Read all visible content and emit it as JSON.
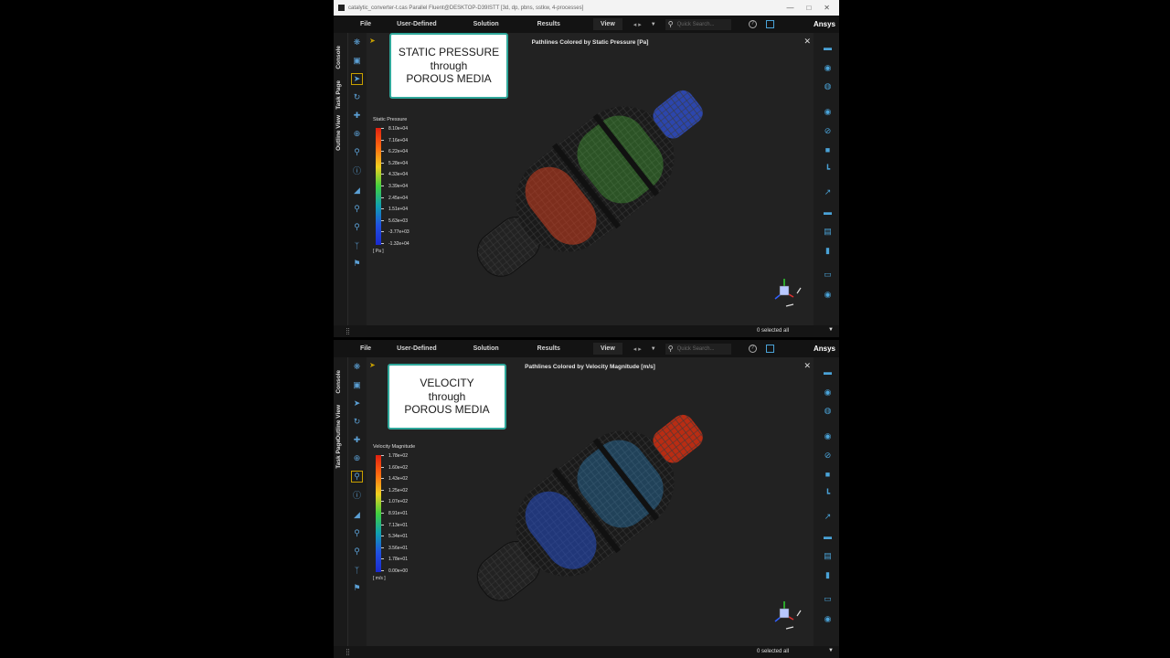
{
  "window": {
    "title": "catalytic_converter-t.cas Parallel Fluent@DESKTOP-D39ISTT [3d, dp, pbns, sstkw, 4-processes]"
  },
  "menu": {
    "file": "File",
    "user_defined": "User-Defined",
    "solution": "Solution",
    "results": "Results",
    "view": "View",
    "search_placeholder": "Quick Search...",
    "brand": "Ansys"
  },
  "side_tabs": {
    "console": "Console",
    "task_page": "Task Page",
    "outline_view": "Outline View"
  },
  "panels": [
    {
      "view_title": "Pathlines Colored by Static Pressure [Pa]",
      "callout": [
        "STATIC PRESSURE",
        "through",
        "POROUS MEDIA"
      ],
      "legend_title": "Static Pressure",
      "legend_labels": [
        "8.10e+04",
        "7.16e+04",
        "6.22e+04",
        "5.28e+04",
        "4.33e+04",
        "3.39e+04",
        "2.45e+04",
        "1.51e+04",
        "5.63e+03",
        "-3.77e+03",
        "-1.32e+04"
      ],
      "legend_unit": "[ Pa ]",
      "status": "0 selected all"
    },
    {
      "view_title": "Pathlines Colored by Velocity Magnitude [m/s]",
      "callout": [
        "VELOCITY",
        "through",
        "POROUS MEDIA"
      ],
      "legend_title": "Velocity Magnitude",
      "legend_labels": [
        "1.78e+02",
        "1.60e+02",
        "1.43e+02",
        "1.25e+02",
        "1.07e+02",
        "8.91e+01",
        "7.13e+01",
        "5.34e+01",
        "3.56e+01",
        "1.78e+01",
        "0.00e+00"
      ],
      "legend_unit": "[ m/s ]",
      "status": "0 selected all"
    }
  ],
  "icons": {
    "left_toolbar": [
      "mesh-display-icon",
      "box-icon",
      "pointer-icon",
      "rotate-icon",
      "pan-icon",
      "zoom-icon",
      "magnify-icon",
      "probe-info-icon",
      "fit-view-icon",
      "zoom-in-icon",
      "zoom-out-icon",
      "axes-icon",
      "lock-icon"
    ],
    "right_toolbar": [
      "layers-icon",
      "shading-icon",
      "transparency-icon",
      "visibility-icon",
      "hide-icon",
      "copy-icon",
      "highlight-icon",
      "plot-icon",
      "slider-icon",
      "report-icon",
      "split-icon",
      "layout-icon",
      "snapshot-icon"
    ]
  },
  "colors": {
    "accent": "#4aa3d8",
    "callout_border": "#2fa79a",
    "background": "#1c1c1c"
  }
}
